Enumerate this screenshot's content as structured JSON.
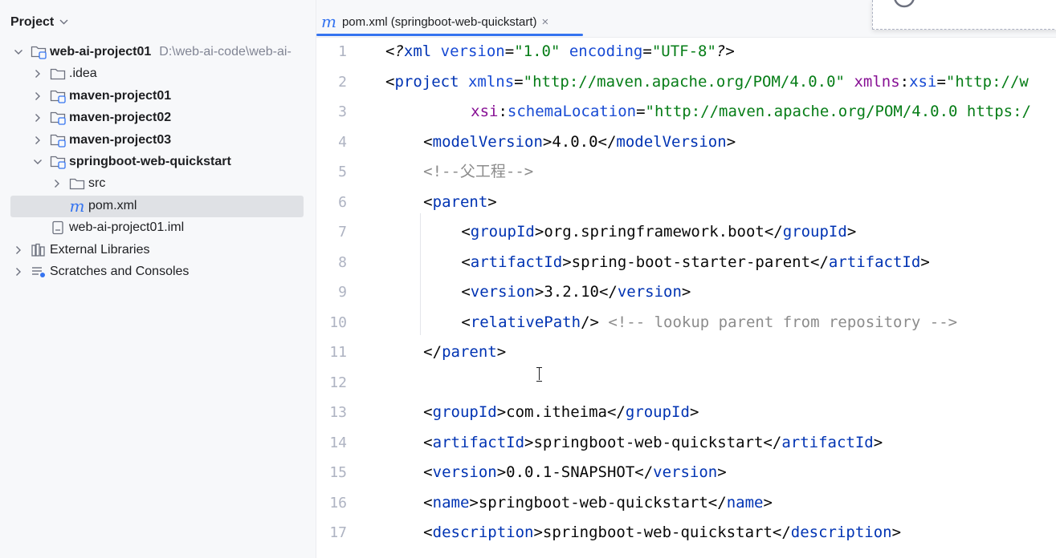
{
  "sidebar": {
    "title": "Project",
    "tree": [
      {
        "label": "web-ai-project01",
        "hint": "D:\\web-ai-code\\web-ai-",
        "icon": "module-folder-icon",
        "arrow": "expanded",
        "depth": 0,
        "bold": true
      },
      {
        "label": ".idea",
        "icon": "folder-icon",
        "arrow": "collapsed",
        "depth": 1,
        "bold": false
      },
      {
        "label": "maven-project01",
        "icon": "module-folder-icon",
        "arrow": "collapsed",
        "depth": 1,
        "bold": true
      },
      {
        "label": "maven-project02",
        "icon": "module-folder-icon",
        "arrow": "collapsed",
        "depth": 1,
        "bold": true
      },
      {
        "label": "maven-project03",
        "icon": "module-folder-icon",
        "arrow": "collapsed",
        "depth": 1,
        "bold": true
      },
      {
        "label": "springboot-web-quickstart",
        "icon": "module-folder-icon",
        "arrow": "expanded",
        "depth": 1,
        "bold": true
      },
      {
        "label": "src",
        "icon": "folder-icon",
        "arrow": "collapsed",
        "depth": 2,
        "bold": false
      },
      {
        "label": "pom.xml",
        "icon": "maven-icon",
        "arrow": "none",
        "depth": 2,
        "bold": false,
        "selected": true
      },
      {
        "label": "web-ai-project01.iml",
        "icon": "iml-file-icon",
        "arrow": "none",
        "depth": 1,
        "bold": false
      },
      {
        "label": "External Libraries",
        "icon": "library-icon",
        "arrow": "collapsed",
        "depth": 0,
        "bold": false
      },
      {
        "label": "Scratches and Consoles",
        "icon": "scratches-icon",
        "arrow": "collapsed",
        "depth": 0,
        "bold": false
      }
    ]
  },
  "tab": {
    "label": "pom.xml (springboot-web-quickstart)",
    "icon": "maven-icon",
    "close": "×"
  },
  "editor": {
    "lines": [
      {
        "n": "1",
        "indent": 0,
        "tokens": [
          [
            "pi",
            "<?"
          ],
          [
            "tag",
            "xml "
          ],
          [
            "attr",
            "version"
          ],
          [
            "plain",
            "="
          ],
          [
            "val",
            "\"1.0\""
          ],
          [
            "plain",
            " "
          ],
          [
            "attr",
            "encoding"
          ],
          [
            "plain",
            "="
          ],
          [
            "val",
            "\"UTF-8\""
          ],
          [
            "pi",
            "?>"
          ]
        ]
      },
      {
        "n": "2",
        "indent": 0,
        "tokens": [
          [
            "plain",
            "<"
          ],
          [
            "tag",
            "project "
          ],
          [
            "attr",
            "xmlns"
          ],
          [
            "plain",
            "="
          ],
          [
            "val",
            "\"http://maven.apache.org/POM/4.0.0\""
          ],
          [
            "plain",
            " "
          ],
          [
            "ns",
            "xmlns"
          ],
          [
            "plain",
            ":"
          ],
          [
            "attr",
            "xsi"
          ],
          [
            "plain",
            "="
          ],
          [
            "val",
            "\"http://w"
          ]
        ]
      },
      {
        "n": "3",
        "indent": 9,
        "tokens": [
          [
            "ns",
            "xsi"
          ],
          [
            "plain",
            ":"
          ],
          [
            "attr",
            "schemaLocation"
          ],
          [
            "plain",
            "="
          ],
          [
            "val",
            "\"http://maven.apache.org/POM/4.0.0 https:/"
          ]
        ]
      },
      {
        "n": "4",
        "indent": 4,
        "tokens": [
          [
            "plain",
            "<"
          ],
          [
            "tag",
            "modelVersion"
          ],
          [
            "plain",
            ">4.0.0</"
          ],
          [
            "tag",
            "modelVersion"
          ],
          [
            "plain",
            ">"
          ]
        ]
      },
      {
        "n": "5",
        "indent": 4,
        "tokens": [
          [
            "comment",
            "<!--父工程-->"
          ]
        ]
      },
      {
        "n": "6",
        "indent": 4,
        "tokens": [
          [
            "plain",
            "<"
          ],
          [
            "tag",
            "parent"
          ],
          [
            "plain",
            ">"
          ]
        ]
      },
      {
        "n": "7",
        "indent": 8,
        "tokens": [
          [
            "plain",
            "<"
          ],
          [
            "tag",
            "groupId"
          ],
          [
            "plain",
            ">org.springframework.boot</"
          ],
          [
            "tag",
            "groupId"
          ],
          [
            "plain",
            ">"
          ]
        ]
      },
      {
        "n": "8",
        "indent": 8,
        "tokens": [
          [
            "plain",
            "<"
          ],
          [
            "tag",
            "artifactId"
          ],
          [
            "plain",
            ">spring-boot-starter-parent</"
          ],
          [
            "tag",
            "artifactId"
          ],
          [
            "plain",
            ">"
          ]
        ]
      },
      {
        "n": "9",
        "indent": 8,
        "tokens": [
          [
            "plain",
            "<"
          ],
          [
            "tag",
            "version"
          ],
          [
            "plain",
            ">3.2.10</"
          ],
          [
            "tag",
            "version"
          ],
          [
            "plain",
            ">"
          ]
        ]
      },
      {
        "n": "10",
        "indent": 8,
        "tokens": [
          [
            "plain",
            "<"
          ],
          [
            "tag",
            "relativePath"
          ],
          [
            "plain",
            "/> "
          ],
          [
            "comment",
            "<!-- lookup parent from repository -->"
          ]
        ]
      },
      {
        "n": "11",
        "indent": 4,
        "tokens": [
          [
            "plain",
            "</"
          ],
          [
            "tag",
            "parent"
          ],
          [
            "plain",
            ">"
          ]
        ]
      },
      {
        "n": "12",
        "indent": 0,
        "tokens": []
      },
      {
        "n": "13",
        "indent": 4,
        "tokens": [
          [
            "plain",
            "<"
          ],
          [
            "tag",
            "groupId"
          ],
          [
            "plain",
            ">com.itheima</"
          ],
          [
            "tag",
            "groupId"
          ],
          [
            "plain",
            ">"
          ]
        ]
      },
      {
        "n": "14",
        "indent": 4,
        "tokens": [
          [
            "plain",
            "<"
          ],
          [
            "tag",
            "artifactId"
          ],
          [
            "plain",
            ">springboot-web-quickstart</"
          ],
          [
            "tag",
            "artifactId"
          ],
          [
            "plain",
            ">"
          ]
        ]
      },
      {
        "n": "15",
        "indent": 4,
        "tokens": [
          [
            "plain",
            "<"
          ],
          [
            "tag",
            "version"
          ],
          [
            "plain",
            ">0.0.1-SNAPSHOT</"
          ],
          [
            "tag",
            "version"
          ],
          [
            "plain",
            ">"
          ]
        ]
      },
      {
        "n": "16",
        "indent": 4,
        "tokens": [
          [
            "plain",
            "<"
          ],
          [
            "tag",
            "name"
          ],
          [
            "plain",
            ">springboot-web-quickstart</"
          ],
          [
            "tag",
            "name"
          ],
          [
            "plain",
            ">"
          ]
        ]
      },
      {
        "n": "17",
        "indent": 4,
        "tokens": [
          [
            "plain",
            "<"
          ],
          [
            "tag",
            "description"
          ],
          [
            "plain",
            ">springboot-web-quickstart</"
          ],
          [
            "tag",
            "description"
          ],
          [
            "plain",
            ">"
          ]
        ]
      }
    ]
  },
  "colors": {
    "accent": "#3574f0",
    "tag": "#0033b3",
    "attr": "#174ad4",
    "namespace": "#871094",
    "string": "#067d17",
    "comment": "#8c8c8c",
    "selection": "#dfe1e5"
  }
}
